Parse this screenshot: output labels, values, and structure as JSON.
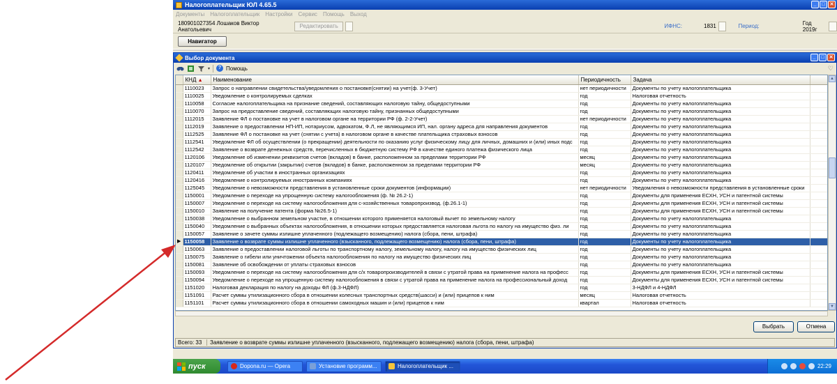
{
  "app": {
    "title": "Налогоплательщик ЮЛ 4.65.5",
    "menu": [
      "Документы",
      "Налогоплательщик",
      "Настройки",
      "Сервис",
      "Помощь",
      "Выход"
    ]
  },
  "info": {
    "taxpayer": "180901027354 Лошаков Виктор Анатольевич",
    "edit_label": "Редактировать",
    "ifns_label": "ИФНС:",
    "ifns_value": "1831",
    "period_label": "Период:",
    "period_value": "Год 2019г"
  },
  "navigator_label": "Навигатор",
  "dialog": {
    "title": "Выбор документа",
    "help_label": "Помощь",
    "columns": {
      "knd": "КНД",
      "name": "Наименование",
      "period": "Периодичность",
      "task": "Задача"
    },
    "rows": [
      {
        "knd": "1110023",
        "name": "Запрос о направлении свидетельства/уведомления о постановке(снятии) на учет(ф. 3-Учет)",
        "period": "нет периодичности",
        "task": "Документы по учету налогоплательщика"
      },
      {
        "knd": "1110025",
        "name": "Уведомление о контролируемых сделках",
        "period": "год",
        "task": "Налоговая отчетность"
      },
      {
        "knd": "1110058",
        "name": "Согласие налогоплательщика на признание сведений, составляющих налоговую тайну, общедоступными",
        "period": "год",
        "task": "Документы по учету налогоплательщика"
      },
      {
        "knd": "1110070",
        "name": "Запрос на предоставление сведений, составляющих налоговую тайну, признанных общедоступными",
        "period": "год",
        "task": "Документы по учету налогоплательщика"
      },
      {
        "knd": "1112015",
        "name": "Заявление ФЛ о постановке на учет в налоговом органе на территории РФ (ф. 2-2-Учет)",
        "period": "нет периодичности",
        "task": "Документы по учету налогоплательщика"
      },
      {
        "knd": "1112019",
        "name": "Заявление о предоставлении НП-ИП, нотариусом, адвокатом, Ф.Л, не являющимся ИП, нал. органу адреса для направления документов",
        "period": "год",
        "task": "Документы по учету налогоплательщика"
      },
      {
        "knd": "1112525",
        "name": "Заявление ФЛ о постановке на учет (снятии с учета) в налоговом органе в качестве плательщика страховых взносов",
        "period": "год",
        "task": "Документы по учету налогоплательщика"
      },
      {
        "knd": "1112541",
        "name": "Уведомление ФЛ об осуществлении (о прекращении) деятельности по оказанию услуг физическому лицу для личных, домашних и (или) иных подс",
        "period": "год",
        "task": "Документы по учету налогоплательщика"
      },
      {
        "knd": "1112542",
        "name": "Заявление о возврате денежных средств, перечисленных в бюджетную систему РФ в качестве единого платежа физического лица",
        "period": "год",
        "task": "Документы по учету налогоплательщика"
      },
      {
        "knd": "1120106",
        "name": "Уведомление об изменении реквизитов счетов (вкладов) в банке, расположенном за пределами территории РФ",
        "period": "месяц",
        "task": "Документы по учету налогоплательщика"
      },
      {
        "knd": "1120107",
        "name": "Уведомление об открытии (закрытии) счетов (вкладов) в банке, расположенном за пределами территории РФ",
        "period": "месяц",
        "task": "Документы по учету налогоплательщика"
      },
      {
        "knd": "1120411",
        "name": "Уведомление об участии в иностранных организациях",
        "period": "год",
        "task": "Документы по учету налогоплательщика"
      },
      {
        "knd": "1120416",
        "name": "Уведомление о контролируемых иностранных компаниях",
        "period": "год",
        "task": "Документы по учету налогоплательщика"
      },
      {
        "knd": "1125045",
        "name": "Уведомление о невозможности представления в установленные сроки документов (информации)",
        "period": "нет периодичности",
        "task": "Уведомления о невозможности представления в установленные сроки"
      },
      {
        "knd": "1150001",
        "name": "Уведомление о переходе на упрощенную систему налогообложения (ф. № 26.2-1)",
        "period": "год",
        "task": "Документы для применения ЕСХН, УСН и патентной системы"
      },
      {
        "knd": "1150007",
        "name": "Уведомление о переходе на систему налогообложения для с-хозяйственных товаропроизвод. (ф.26.1-1)",
        "period": "год",
        "task": "Документы для применения ЕСХН, УСН и патентной системы"
      },
      {
        "knd": "1150010",
        "name": "Заявление на получение патента (форма №26.5-1)",
        "period": "год",
        "task": "Документы для применения ЕСХН, УСН и патентной системы"
      },
      {
        "knd": "1150038",
        "name": "Уведомление о выбранном земельном участке, в отношении которого применяется налоговый вычет по земельному налогу",
        "period": "год",
        "task": "Документы по учету налогоплательщика"
      },
      {
        "knd": "1150040",
        "name": "Уведомление о выбранных объектах налогообложения, в отношении которых предоставляется налоговая льгота по налогу на имущество физ. ли",
        "period": "год",
        "task": "Документы по учету налогоплательщика"
      },
      {
        "knd": "1150057",
        "name": "Заявление о зачете суммы излишне уплаченного (подлежащего возмещению) налога (сбора, пени, штрафа)",
        "period": "год",
        "task": "Документы по учету налогоплательщика"
      },
      {
        "knd": "1150058",
        "name": "Заявление о возврате суммы излишне уплаченного (взысканного, подлежащего возмещению) налога (сбора, пени, штрафа)",
        "period": "год",
        "task": "Документы по учету налогоплательщика"
      },
      {
        "knd": "1150063",
        "name": "Заявление о предоставлении налоговой льготы по транспортному налогу, земельному налогу, налогу на имущество физических лиц",
        "period": "год",
        "task": "Документы по учету налогоплательщика"
      },
      {
        "knd": "1150075",
        "name": "Заявление о гибели или уничтожении объекта налогообложения по налогу на имущество физических лиц",
        "period": "год",
        "task": "Документы по учету налогоплательщика"
      },
      {
        "knd": "1150081",
        "name": "Заявление об освобождении от уплаты страховых взносов",
        "period": "год",
        "task": "Документы по учету налогоплательщика"
      },
      {
        "knd": "1150093",
        "name": "Уведомление о переходе на систему налогообложения для с/х товаропроизводителей в связи с утратой права на применение налога на професс",
        "period": "год",
        "task": "Документы для применения ЕСХН, УСН и патентной системы"
      },
      {
        "knd": "1150094",
        "name": "Уведомление о переходе на упрощенную систему налогообложения в связи с утратой права на применение налога на профессиональный доход",
        "period": "год",
        "task": "Документы для применения ЕСХН, УСН и патентной системы"
      },
      {
        "knd": "1151020",
        "name": "Налоговая декларация по налогу на доходы ФЛ (ф.3-НДФЛ)",
        "period": "год",
        "task": "3-НДФЛ и 4-НДФЛ"
      },
      {
        "knd": "1151091",
        "name": "Расчет суммы утилизационного сбора в отношении колесных транспортных средств(шасси) и (или) прицепов к ним",
        "period": "месяц",
        "task": "Налоговая отчетность"
      },
      {
        "knd": "1151101",
        "name": "Расчет суммы утилизационного сбора в отношении самоходных машин и (или) прицепов к ним",
        "period": "квартал",
        "task": "Налоговая отчетность"
      }
    ],
    "selected_index": 20,
    "select_label": "Выбрать",
    "cancel_label": "Отмена",
    "status_count": "Всего: 33",
    "status_text": "Заявление о возврате суммы излишне уплаченного (взысканного, подлежащего возмещению) налога (сбора, пени, штрафа)"
  },
  "taskbar": {
    "start_label": "пуск",
    "tasks": [
      {
        "label": "Dopona.ru — Opera",
        "color": "#d8281c"
      },
      {
        "label": "Установие программ...",
        "color": "#7aa0d8"
      },
      {
        "label": "Налогоплательщик ...",
        "color": "#f6c43b"
      }
    ],
    "clock": "22:29"
  },
  "colors": {
    "selection": "#2e5fa8",
    "title": "#0a3fb0",
    "arrow": "#d42a2a"
  }
}
